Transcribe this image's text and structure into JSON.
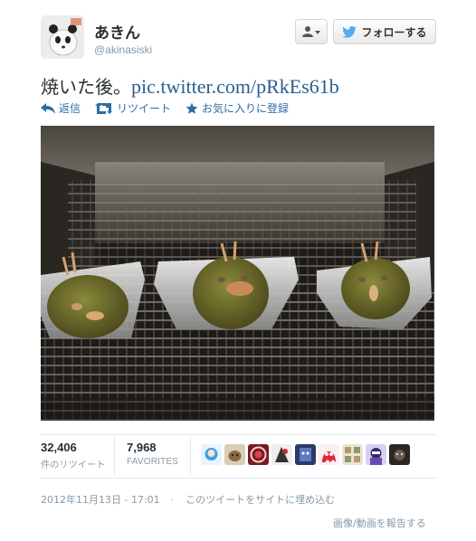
{
  "user": {
    "name": "あきん",
    "handle": "@akinasiski"
  },
  "buttons": {
    "follow_label": "フォローする"
  },
  "tweet": {
    "text": "焼いた後。",
    "link": "pic.twitter.com/pRkEs61b"
  },
  "actions": {
    "reply": "返信",
    "retweet": "リツイート",
    "favorite": "お気に入りに登録"
  },
  "stats": {
    "retweets_count": "32,406",
    "retweets_label": "件のリツイート",
    "favorites_count": "7,968",
    "favorites_label": "FAVORITES"
  },
  "meta": {
    "timestamp": "2012年11月13日 - 17:01",
    "separator": "·",
    "embed": "このツイートをサイトに埋め込む"
  },
  "report": "画像/動画を報告する",
  "colors": {
    "link": "#2a5f8f",
    "action": "#2a6ea8",
    "muted": "#8899a6",
    "twitter_bird": "#55acee"
  },
  "favoriters": [
    {
      "icon": "avatar-blue-anime"
    },
    {
      "icon": "avatar-dog"
    },
    {
      "icon": "avatar-red-circle"
    },
    {
      "icon": "avatar-dark-figure"
    },
    {
      "icon": "avatar-navy-character"
    },
    {
      "icon": "avatar-red-ghost"
    },
    {
      "icon": "avatar-pattern"
    },
    {
      "icon": "avatar-purple-character"
    },
    {
      "icon": "avatar-dark-photo"
    }
  ]
}
